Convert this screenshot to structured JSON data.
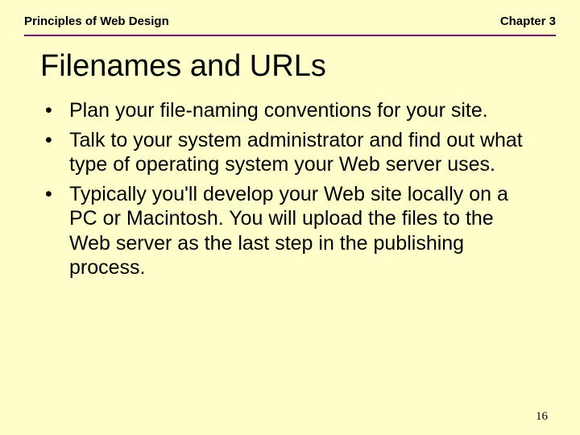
{
  "header": {
    "left": "Principles of Web Design",
    "right": "Chapter 3"
  },
  "title": "Filenames and URLs",
  "bullets": [
    "Plan your file-naming conventions for your site.",
    "Talk to your system administrator and find out what type of operating system your Web server uses.",
    "Typically you'll develop your Web site locally on a PC or Macintosh. You will upload the files to the Web server as the last step in the publishing process."
  ],
  "page_number": "16"
}
